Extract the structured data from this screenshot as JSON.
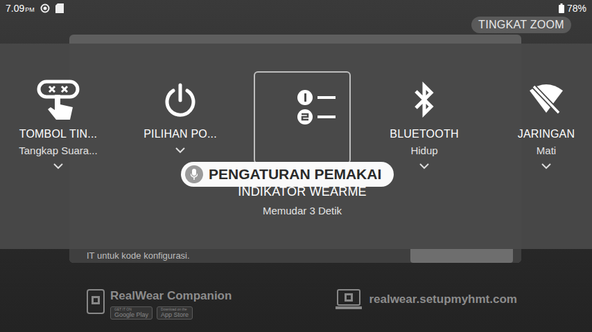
{
  "status_bar": {
    "time": "7.09",
    "ampm": "PM",
    "battery": "78%"
  },
  "zoom_label": "TINGKAT ZOOM",
  "background": {
    "hint": "IT untuk kode konfigurasi."
  },
  "settings": [
    {
      "kind": "action-button",
      "title": "TOMBOL TIN...",
      "subtitle": "Tangkap Suara...",
      "expandable": true,
      "selected": false
    },
    {
      "kind": "power",
      "title": "PILIHAN PO...",
      "subtitle": "",
      "expandable": true,
      "selected": false
    },
    {
      "kind": "indicator",
      "title": "INDIKATOR WEARME",
      "subtitle": "Memudar 3 Detik",
      "expandable": false,
      "selected": true
    },
    {
      "kind": "bluetooth",
      "title": "BLUETOOTH",
      "subtitle": "Hidup",
      "expandable": true,
      "selected": false
    },
    {
      "kind": "network",
      "title": "JARINGAN",
      "subtitle": "Mati",
      "expandable": true,
      "selected": false
    }
  ],
  "voice_tooltip": "PENGATURAN PEMAKAI",
  "footer": {
    "companion": "RealWear Companion",
    "badges": [
      {
        "small": "GET IT ON",
        "big": "Google Play"
      },
      {
        "small": "Download on the",
        "big": "App Store"
      }
    ],
    "url": "realwear.setupmyhmt.com"
  }
}
